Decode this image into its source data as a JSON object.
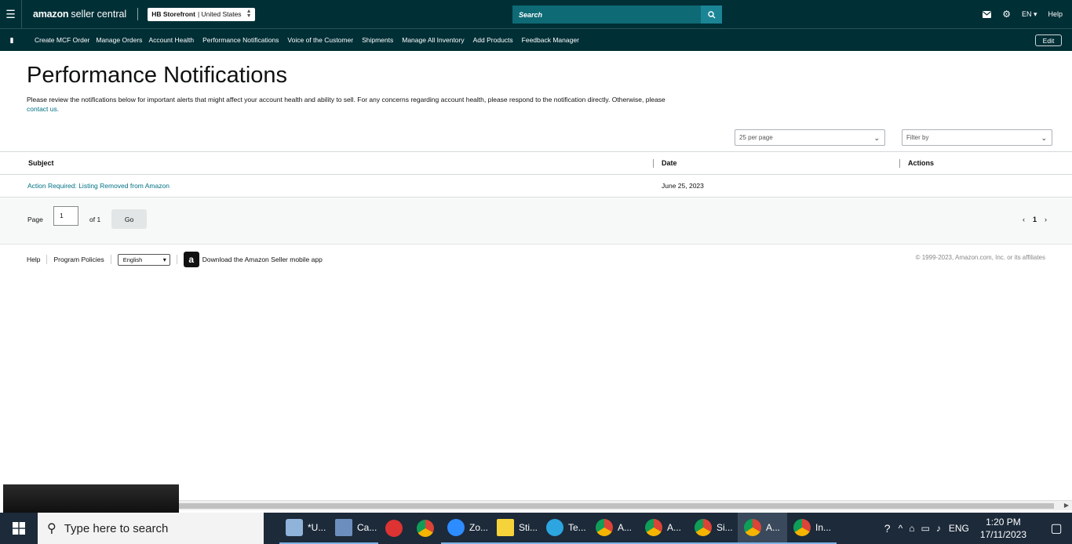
{
  "header": {
    "logo_brand": "amazon",
    "logo_product": "seller central",
    "store_bold": "HB Storefront",
    "store_rest": "| United States",
    "search_placeholder": "Search",
    "lang": "EN ▾",
    "help": "Help",
    "bg_color": "#002f36"
  },
  "nav": {
    "items": [
      "Create MCF Order",
      "Manage Orders",
      "Account Health",
      "Performance Notifications",
      "Voice of the Customer",
      "Shipments",
      "Manage All Inventory",
      "Add Products",
      "Feedback Manager"
    ],
    "edit": "Edit"
  },
  "page": {
    "title": "Performance Notifications",
    "intro": "Please review the notifications below for important alerts that might affect your account health and ability to sell. For any concerns regarding account health, please respond to the notification directly. Otherwise, please",
    "intro_link": "contact us.",
    "per_page": "25 per page",
    "filter": "Filter by"
  },
  "table": {
    "headers": [
      "Subject",
      "Date",
      "Actions"
    ],
    "rows": [
      {
        "subject": "Action Required: Listing Removed from Amazon",
        "date": "June 25, 2023",
        "actions": ""
      }
    ]
  },
  "pager": {
    "page_label": "Page",
    "page_value": "1",
    "of_label": "of 1",
    "go": "Go",
    "prev": "‹",
    "current": "1",
    "next": "›"
  },
  "footer": {
    "help": "Help",
    "policies": "Program Policies",
    "language": "English",
    "app_text": "Download the Amazon Seller mobile app",
    "copyright": "© 1999-2023, Amazon.com, Inc. or its affiliates"
  },
  "taskbar": {
    "search": "Type here to search",
    "apps": [
      {
        "label": "*U...",
        "color": "#8fb3d9"
      },
      {
        "label": "Ca...",
        "color": "#6c8ebf"
      },
      {
        "label": "",
        "color": "#d33"
      },
      {
        "label": "",
        "color": "#f4b400"
      },
      {
        "label": "Zo...",
        "color": "#2d8cff"
      },
      {
        "label": "Sti...",
        "color": "#f7d33b"
      },
      {
        "label": "Te...",
        "color": "#2ca5e0"
      },
      {
        "label": "A...",
        "color": "#f4b400"
      },
      {
        "label": "A...",
        "color": "#f4b400"
      },
      {
        "label": "Si...",
        "color": "#f4b400"
      },
      {
        "label": "A...",
        "color": "#f4b400"
      },
      {
        "label": "In...",
        "color": "#f4b400"
      }
    ],
    "lang": "ENG",
    "time": "1:20 PM",
    "date": "17/11/2023"
  }
}
